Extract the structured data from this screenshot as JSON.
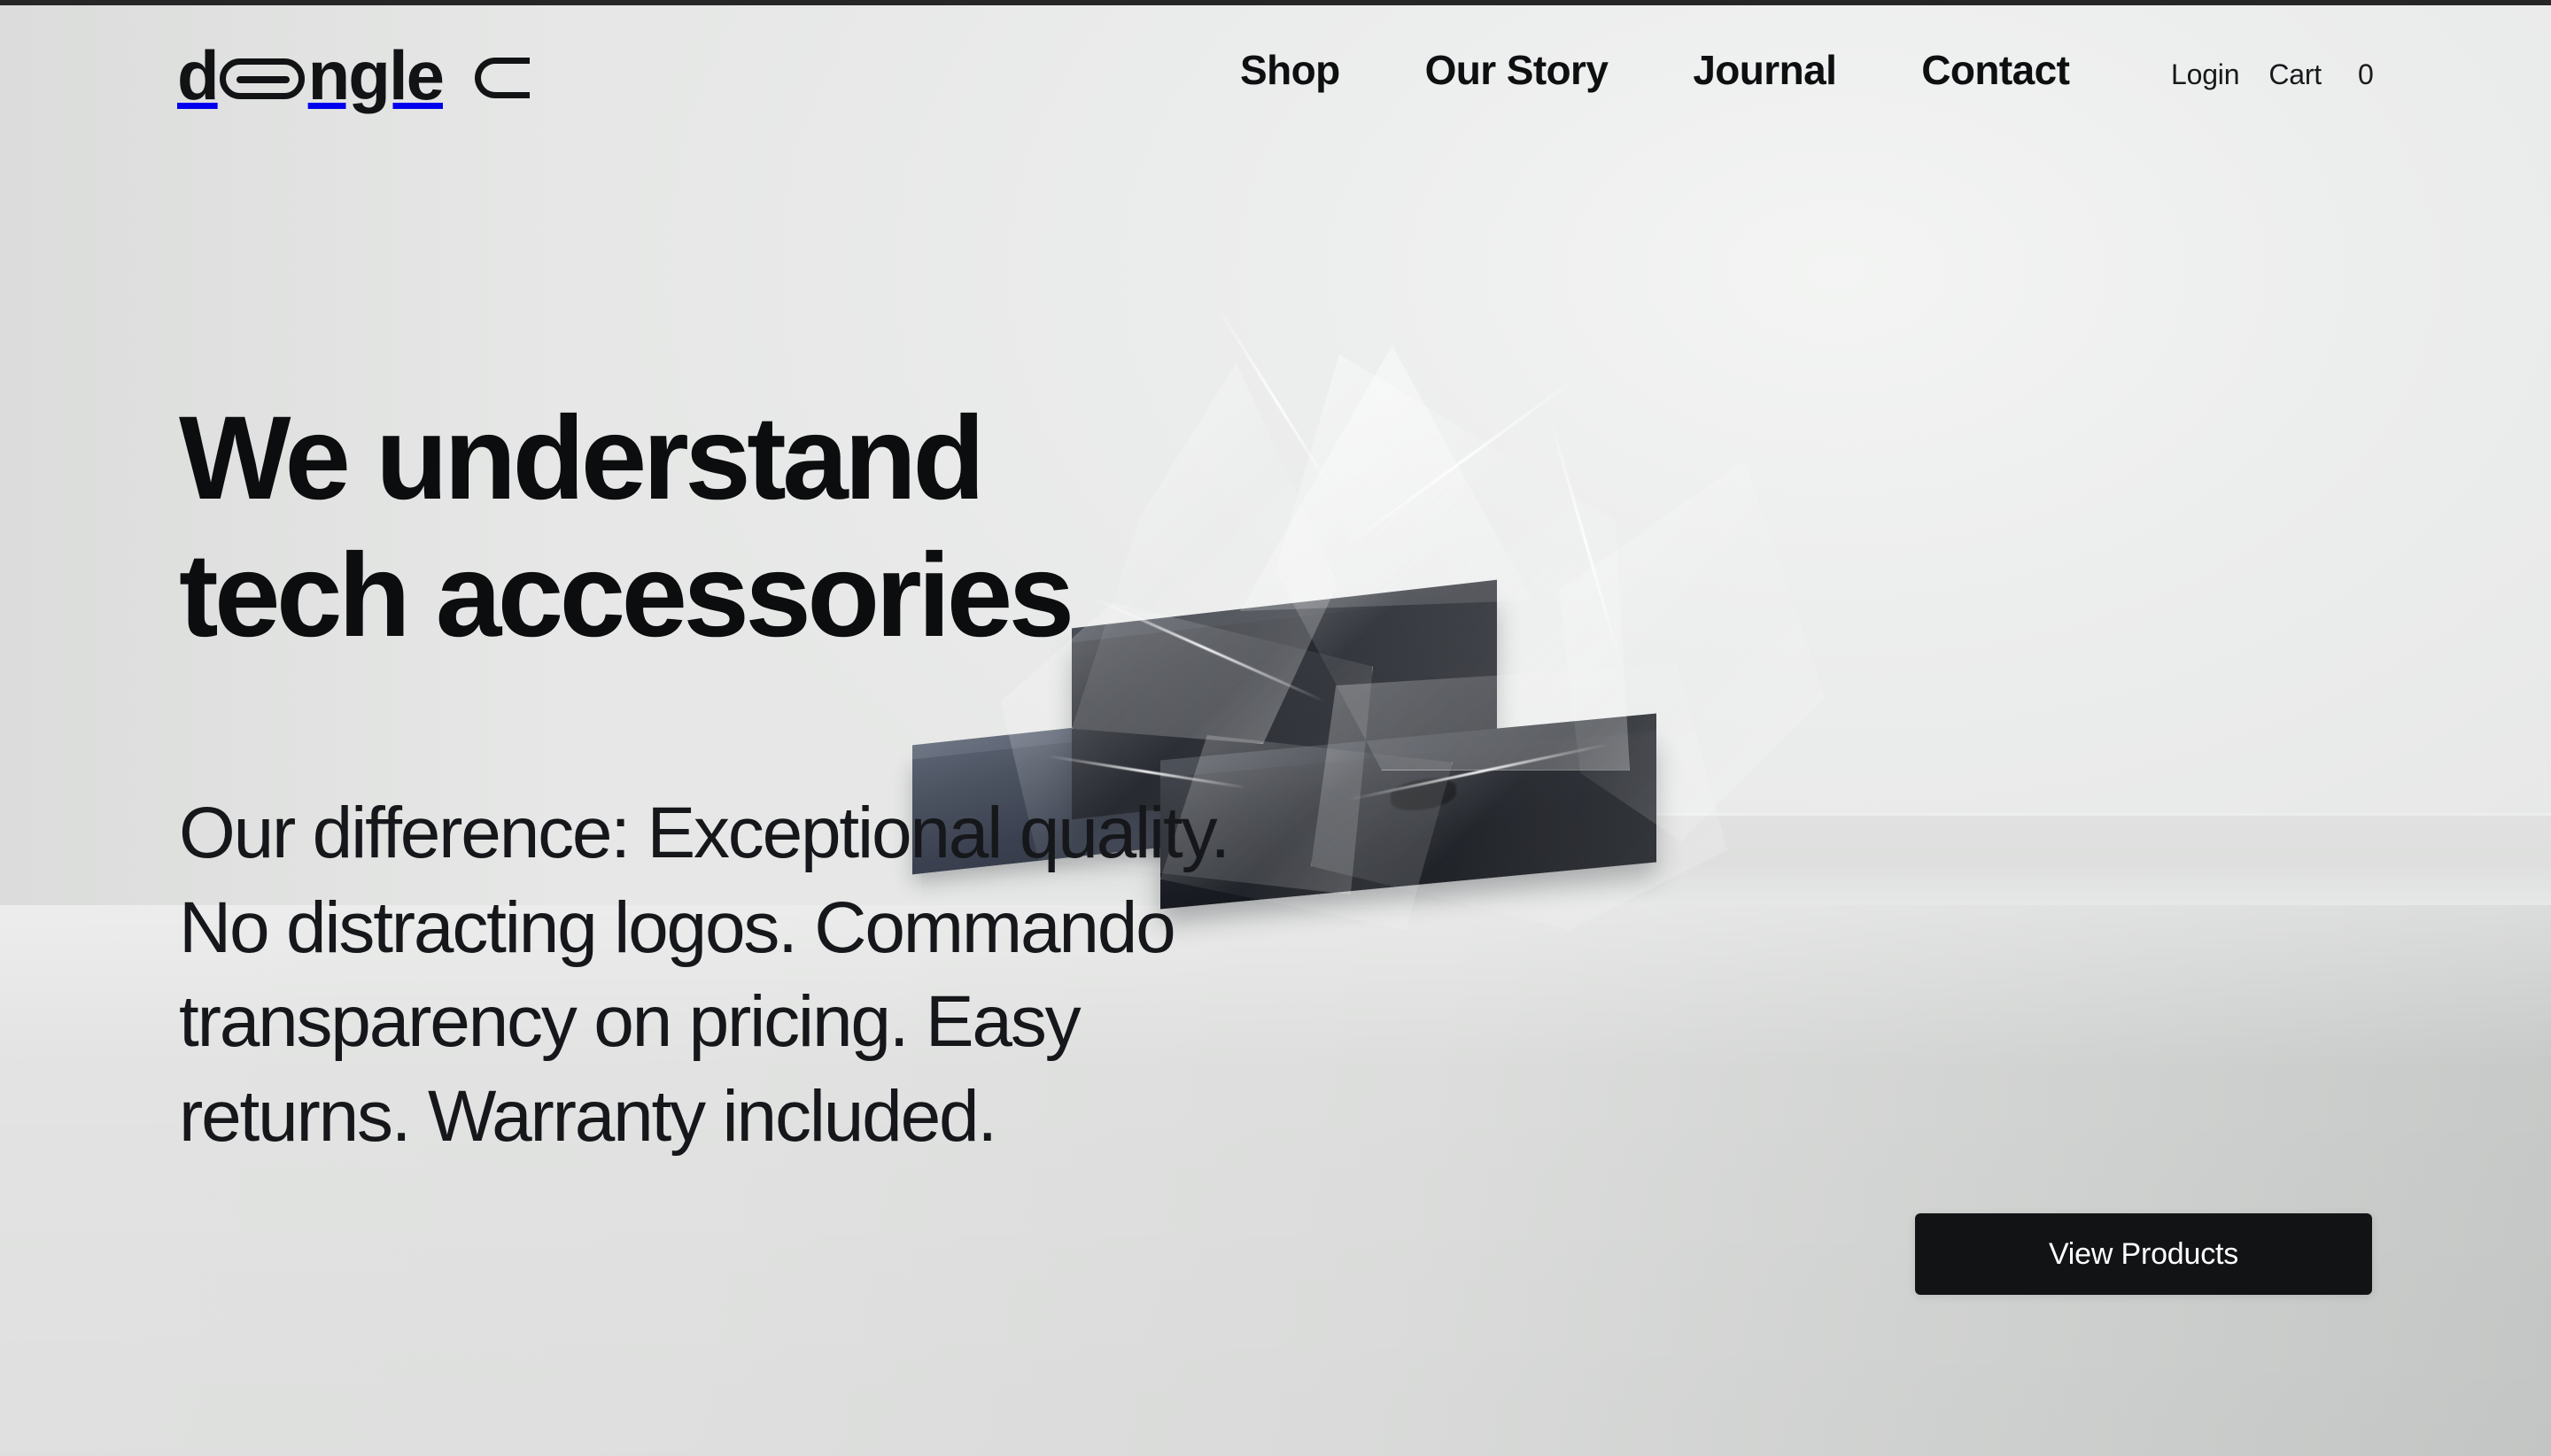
{
  "brand": {
    "name": "dongle",
    "logo_prefix": "d",
    "logo_suffix": "ngle",
    "logo_o_icon": "usb-c-connector-icon",
    "logo_mark_icon": "c-connector-mark-icon"
  },
  "nav": {
    "items": [
      {
        "label": "Shop"
      },
      {
        "label": "Our Story"
      },
      {
        "label": "Journal"
      },
      {
        "label": "Contact"
      }
    ]
  },
  "utility": {
    "login_label": "Login",
    "cart_label": "Cart",
    "cart_count": "0"
  },
  "hero": {
    "title_line_1": "We understand",
    "title_line_2": "tech accessories",
    "body": "Our difference: Exceptional quality. No distracting logos. Commando transparency on pricing. Easy returns. Warranty included.",
    "cta_label": "View Products"
  },
  "media": {
    "hero_image_alt": "black product boxes wrapped in transparent plastic bag on white surface"
  },
  "colors": {
    "ink": "#0b0d0e",
    "button_bg": "#121315",
    "button_text": "#ffffff",
    "page_bg_top": "#eceded",
    "page_bg_bottom": "#cfd1d0",
    "top_strip": "#262626"
  }
}
